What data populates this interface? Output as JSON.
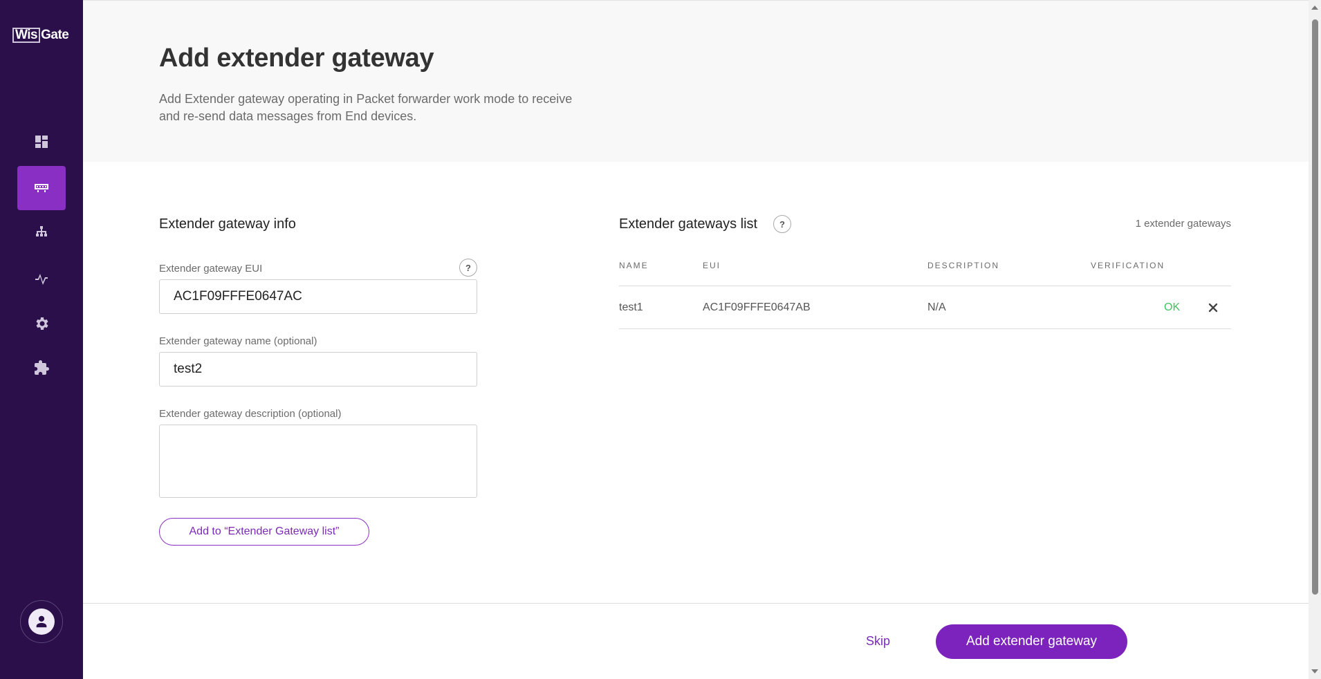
{
  "app": {
    "logo_box": "Wis",
    "logo_text": "Gate"
  },
  "sidebar": {
    "items": [
      {
        "icon": "dashboard-icon",
        "active": false
      },
      {
        "icon": "gateway-icon",
        "active": true
      },
      {
        "icon": "network-icon",
        "active": false
      },
      {
        "icon": "activity-icon",
        "active": false
      },
      {
        "icon": "gear-icon",
        "active": false
      },
      {
        "icon": "extension-icon",
        "active": false
      }
    ],
    "profile_icon": "user-icon"
  },
  "header": {
    "title": "Add extender gateway",
    "subtitle": "Add Extender gateway operating in Packet forwarder work mode to receive and re-send data messages from End devices."
  },
  "form": {
    "section_title": "Extender gateway info",
    "eui_label": "Extender gateway EUI",
    "eui_value": "AC1F09FFFE0647AC",
    "help_glyph": "?",
    "name_label": "Extender gateway name (optional)",
    "name_value": "test2",
    "description_label": "Extender gateway description (optional)",
    "description_value": "",
    "add_button": "Add to “Extender Gateway list”"
  },
  "list": {
    "section_title": "Extender gateways list",
    "help_glyph": "?",
    "count": "1 extender gateways",
    "columns": [
      "NAME",
      "EUI",
      "DESCRIPTION",
      "VERIFICATION"
    ],
    "rows": [
      {
        "name": "test1",
        "eui": "AC1F09FFFE0647AB",
        "description": "N/A",
        "verification": "OK"
      }
    ]
  },
  "footer": {
    "skip": "Skip",
    "primary": "Add extender gateway"
  },
  "colors": {
    "sidebar_bg": "#2a0f4a",
    "accent": "#7d23bd",
    "ok": "#3fc35f"
  }
}
